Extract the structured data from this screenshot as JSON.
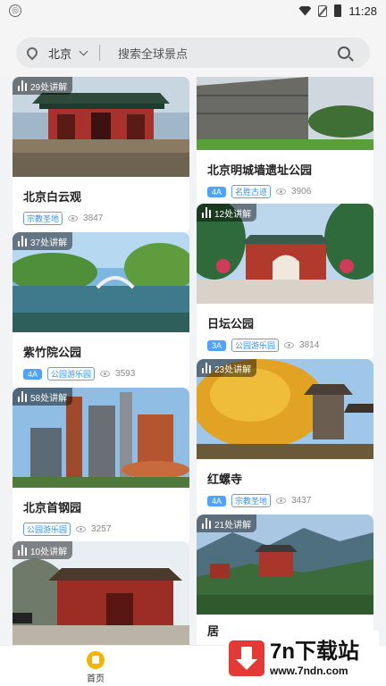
{
  "status_bar": {
    "time": "11:28",
    "left_icon_glyph": "◎"
  },
  "search": {
    "city": "北京",
    "placeholder": "搜索全球景点"
  },
  "cards": [
    {
      "guides": "29处讲解",
      "title": "北京白云观",
      "level": "",
      "category": "宗教圣地",
      "views": "3847"
    },
    {
      "guides": "37处讲解",
      "title": "紫竹院公园",
      "level": "4A",
      "category": "公园游乐园",
      "views": "3593"
    },
    {
      "guides": "58处讲解",
      "title": "北京首钢园",
      "level": "",
      "category": "公园游乐园",
      "views": "3257"
    },
    {
      "guides": "10处讲解",
      "title": "",
      "level": "",
      "category": "",
      "views": ""
    },
    {
      "guides": "",
      "title": "北京明城墙遗址公园",
      "level": "4A",
      "category": "名胜古迹",
      "views": "3906"
    },
    {
      "guides": "12处讲解",
      "title": "日坛公园",
      "level": "3A",
      "category": "公园游乐园",
      "views": "3814"
    },
    {
      "guides": "23处讲解",
      "title": "红螺寺",
      "level": "4A",
      "category": "宗教圣地",
      "views": "3437"
    },
    {
      "guides": "21处讲解",
      "title": "居",
      "level": "",
      "category": "",
      "views": ""
    }
  ],
  "bottom_nav": {
    "home_label": "首页"
  },
  "watermark": {
    "title": "7n下载站",
    "url": "www.7ndn.com"
  },
  "colors": {
    "accent": "#4da3ff",
    "nav_icon": "#f5b400",
    "watermark_red": "#e53935"
  }
}
